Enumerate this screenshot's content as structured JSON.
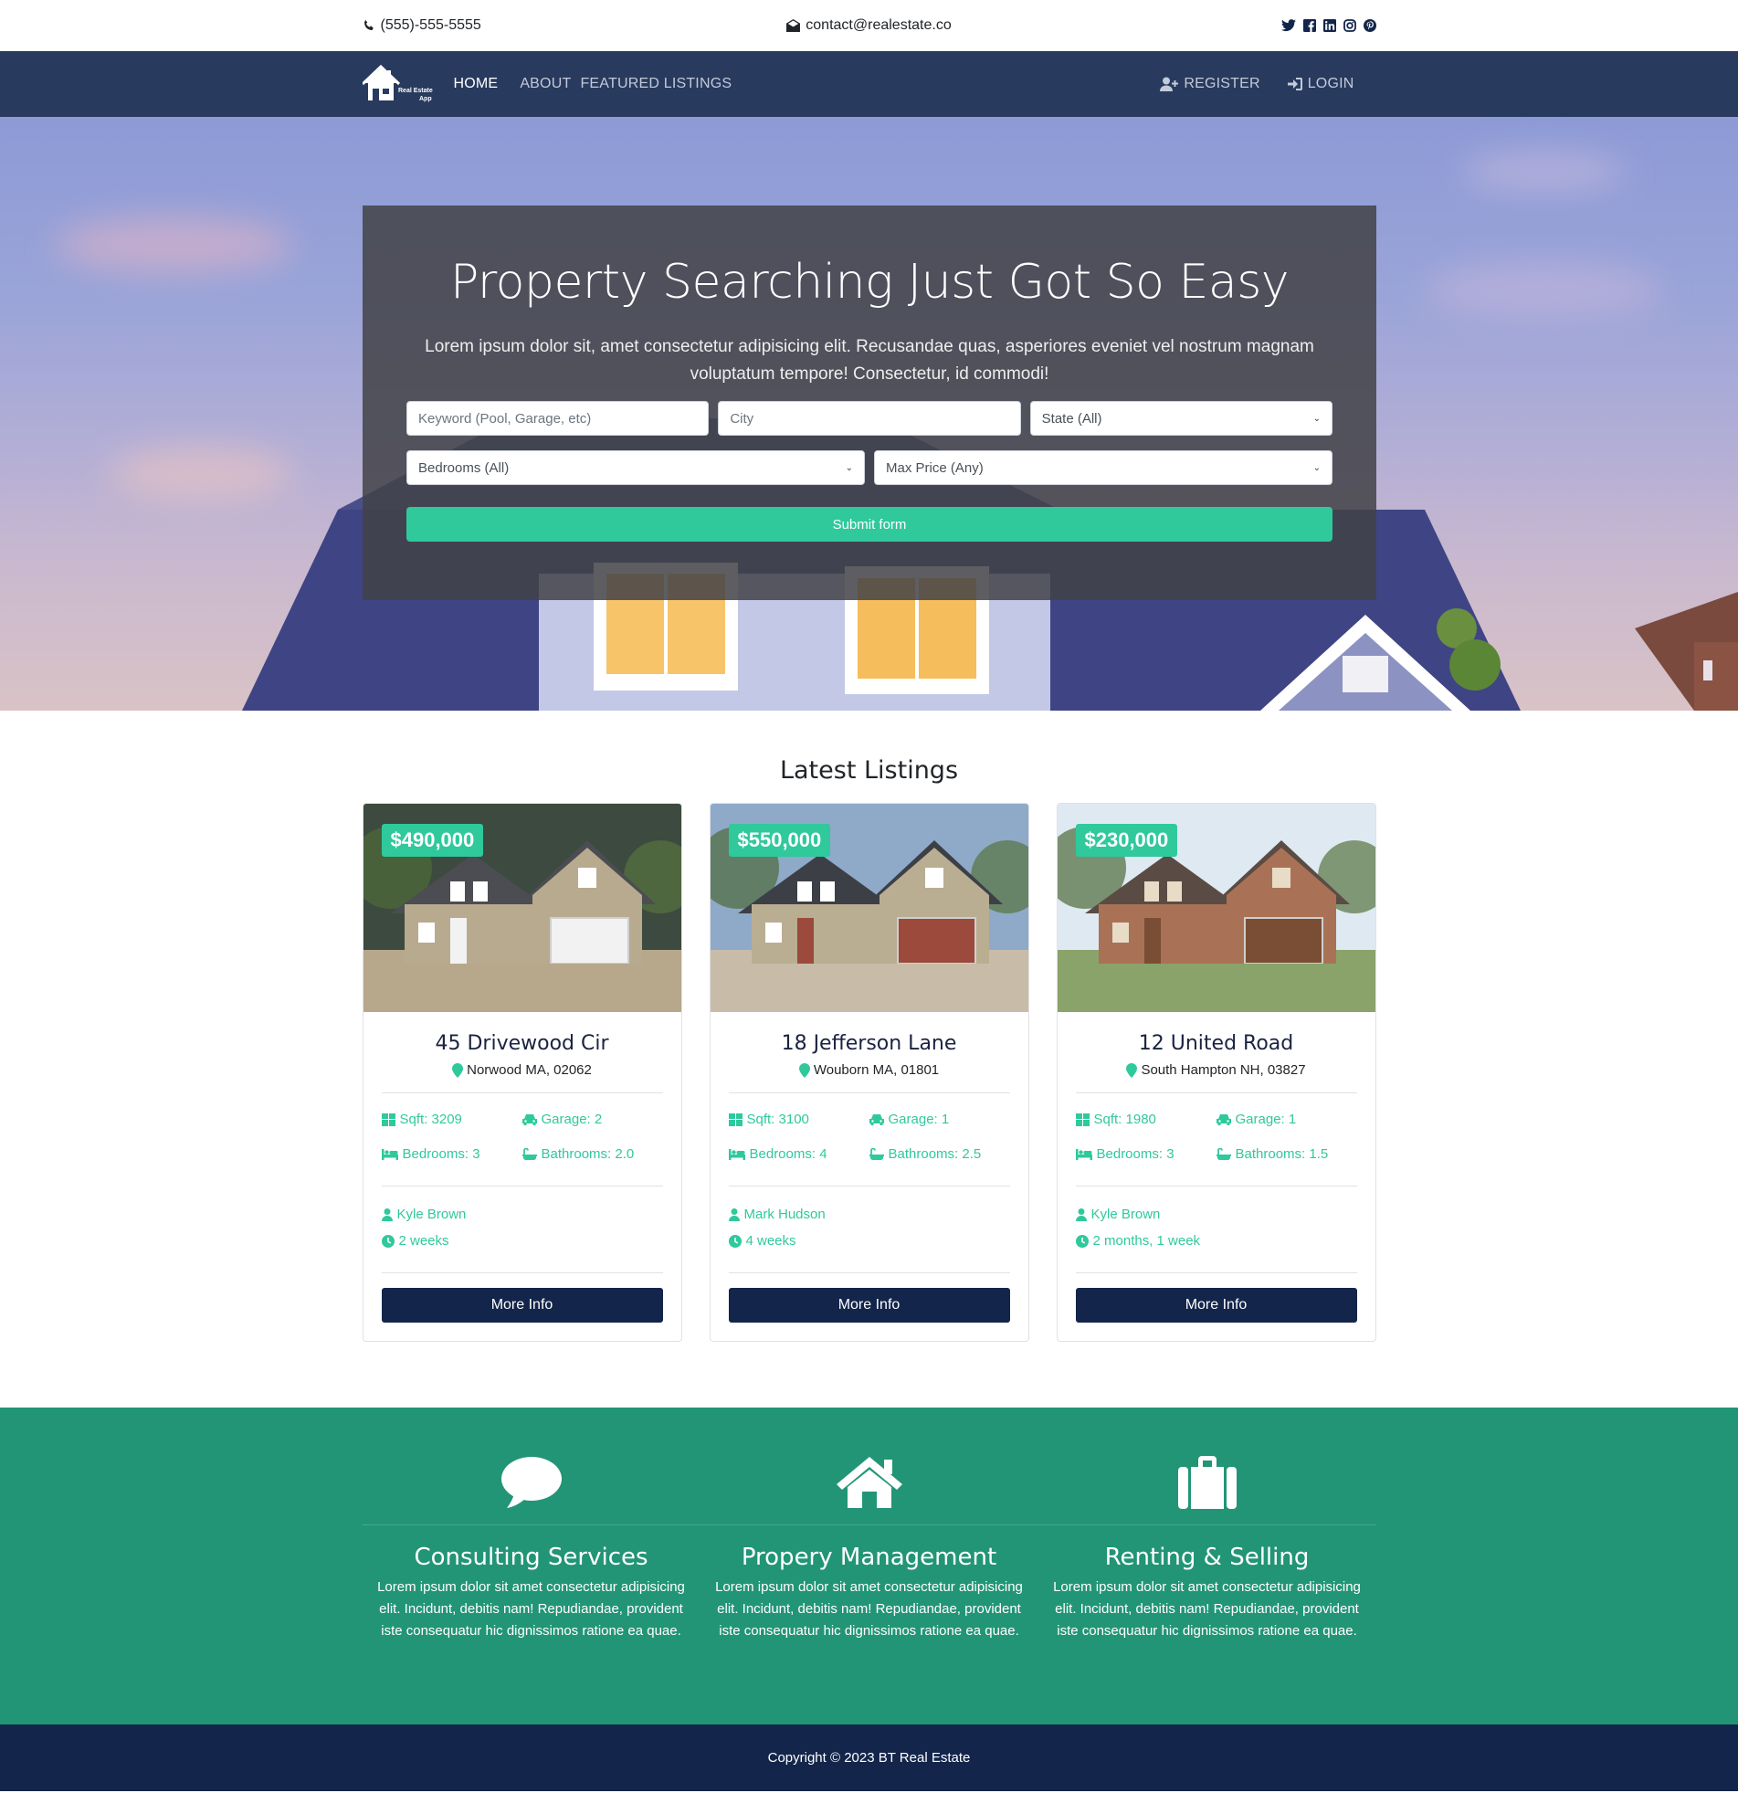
{
  "topbar": {
    "phone": "(555)-555-5555",
    "email": "contact@realestate.co",
    "social_icons": [
      "twitter-icon",
      "facebook-icon",
      "linkedin-icon",
      "instagram-icon",
      "pinterest-icon"
    ]
  },
  "navbar": {
    "brand_line1": "Real Estate",
    "brand_line2": "App",
    "links": [
      "HOME",
      "ABOUT",
      "FEATURED LISTINGS"
    ],
    "register": "REGISTER",
    "login": "LOGIN"
  },
  "hero": {
    "title": "Property Searching Just Got So Easy",
    "subtitle": "Lorem ipsum dolor sit, amet consectetur adipisicing elit. Recusandae quas, asperiores eveniet vel nostrum magnam voluptatum tempore! Consectetur, id commodi!",
    "keyword_placeholder": "Keyword (Pool, Garage, etc)",
    "city_placeholder": "City",
    "state_select": "State (All)",
    "bedrooms_select": "Bedrooms (All)",
    "price_select": "Max Price (Any)",
    "submit": "Submit form"
  },
  "listings": {
    "heading": "Latest Listings",
    "items": [
      {
        "price": "$490,000",
        "title": "45 Drivewood Cir",
        "location": "Norwood MA, 02062",
        "sqft": "Sqft: 3209",
        "garage": "Garage: 2",
        "bedrooms": "Bedrooms: 3",
        "bathrooms": "Bathrooms: 2.0",
        "realtor": "Kyle Brown",
        "age": "2 weeks",
        "button": "More Info"
      },
      {
        "price": "$550,000",
        "title": "18 Jefferson Lane",
        "location": "Wouborn MA, 01801",
        "sqft": "Sqft: 3100",
        "garage": "Garage: 1",
        "bedrooms": "Bedrooms: 4",
        "bathrooms": "Bathrooms: 2.5",
        "realtor": "Mark Hudson",
        "age": "4 weeks",
        "button": "More Info"
      },
      {
        "price": "$230,000",
        "title": "12 United Road",
        "location": "South Hampton NH, 03827",
        "sqft": "Sqft: 1980",
        "garage": "Garage: 1",
        "bedrooms": "Bedrooms: 3",
        "bathrooms": "Bathrooms: 1.5",
        "realtor": "Kyle Brown",
        "age": "2 months, 1 week",
        "button": "More Info"
      }
    ]
  },
  "services": [
    {
      "icon": "comment-icon",
      "title": "Consulting Services",
      "text": "Lorem ipsum dolor sit amet consectetur adipisicing elit. Incidunt, debitis nam! Repudiandae, provident iste consequatur hic dignissimos ratione ea quae."
    },
    {
      "icon": "home-icon",
      "title": "Propery Management",
      "text": "Lorem ipsum dolor sit amet consectetur adipisicing elit. Incidunt, debitis nam! Repudiandae, provident iste consequatur hic dignissimos ratione ea quae."
    },
    {
      "icon": "suitcase-icon",
      "title": "Renting & Selling",
      "text": "Lorem ipsum dolor sit amet consectetur adipisicing elit. Incidunt, debitis nam! Repudiandae, provident iste consequatur hic dignissimos ratione ea quae."
    }
  ],
  "footer": {
    "copyright": "Copyright © 2023 BT Real Estate"
  },
  "colors": {
    "navy": "#283a5e",
    "dark_navy": "#13254a",
    "accent": "#2fc99c",
    "services_bg": "#229576"
  }
}
